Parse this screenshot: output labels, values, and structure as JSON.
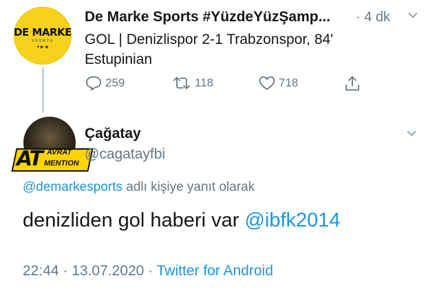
{
  "tweet_parent": {
    "avatar": {
      "text": "DE MARKE",
      "subtext": "SPORTS",
      "icons": "♥ ▶ ◉",
      "color": "#f7d21a"
    },
    "display_name": "De Marke Sports #YüzdeYüzŞamp...",
    "separator": "·",
    "time": "4 dk",
    "text_line1": "GOL | Denizlispor 2-1 Trabzonspor, 84'",
    "text_line2": "Estupinian",
    "actions": {
      "reply_icon": "reply-icon",
      "reply_count": "259",
      "retweet_icon": "retweet-icon",
      "retweet_count": "118",
      "like_icon": "heart-icon",
      "like_count": "718",
      "share_icon": "share-icon"
    }
  },
  "tweet_main": {
    "avatar": {
      "badge_big": "AT",
      "badge_top": "AVRAT",
      "badge_bottom": "MENTION",
      "color": "#ffd400"
    },
    "display_name": "Çağatay",
    "handle": "@cagatayfbi",
    "reply_to_mention": "@demarkesports",
    "reply_to_suffix": " adlı kişiye yanıt olarak",
    "text": "denizliden gol haberi var ",
    "text_mention": "@ibfk2014",
    "time": "22:44",
    "date": "13.07.2020",
    "source": "Twitter for Android",
    "meta_separator": " · "
  },
  "colors": {
    "link": "#1b95e0",
    "muted": "#657786",
    "text": "#14171a"
  }
}
